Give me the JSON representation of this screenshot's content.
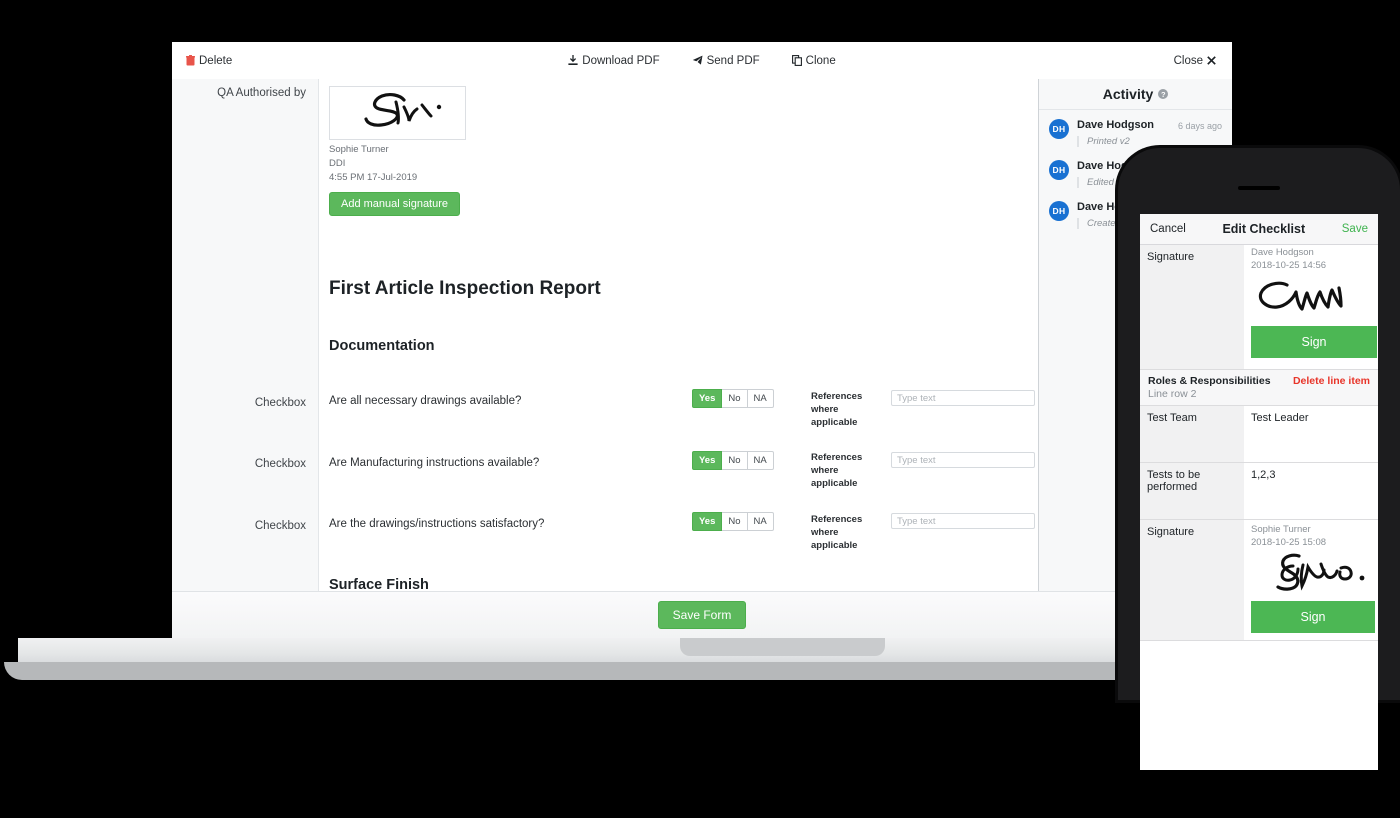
{
  "toolbar": {
    "delete_label": "Delete",
    "download_label": "Download PDF",
    "send_label": "Send PDF",
    "clone_label": "Clone",
    "close_label": "Close",
    "delete_icon": "trash-icon",
    "download_icon": "download-icon",
    "send_icon": "paper-plane-icon",
    "clone_icon": "copy-icon",
    "close_icon": "close-x-icon",
    "delete_color": "#e8544a"
  },
  "signature_block": {
    "label": "QA Authorised by",
    "name": "Sophie Turner",
    "role": "DDI",
    "timestamp": "4:55 PM 17-Jul-2019",
    "add_button": "Add manual signature"
  },
  "form": {
    "title": "First Article Inspection Report",
    "section_1": "Documentation",
    "section_2": "Surface Finish",
    "row_label": "Checkbox",
    "ref_label": "References where applicable",
    "input_placeholder": "Type text",
    "toggle_options": [
      "Yes",
      "No",
      "NA"
    ],
    "rows": [
      {
        "label": "Checkbox",
        "question": "Are all necessary drawings available?",
        "selected": "Yes",
        "ref_label": "References where applicable",
        "value": ""
      },
      {
        "label": "Checkbox",
        "question": "Are Manufacturing instructions available?",
        "selected": "Yes",
        "ref_label": "References where applicable",
        "value": ""
      },
      {
        "label": "Checkbox",
        "question": "Are the drawings/instructions satisfactory?",
        "selected": "Yes",
        "ref_label": "References where applicable",
        "value": ""
      }
    ],
    "save_button": "Save Form"
  },
  "activity": {
    "title": "Activity",
    "help_icon": "question-mark-icon",
    "accent": "#1971d2",
    "items": [
      {
        "initials": "DH",
        "name": "Dave Hodgson",
        "time": "6 days ago",
        "action": "Printed v2"
      },
      {
        "initials": "DH",
        "name": "Dave Hodgson",
        "time": "",
        "action": "Edited"
      },
      {
        "initials": "DH",
        "name": "Dave Hodgson",
        "time": "",
        "action": "Created"
      }
    ]
  },
  "phone": {
    "nav": {
      "cancel": "Cancel",
      "title": "Edit Checklist",
      "save": "Save"
    },
    "rows": [
      {
        "type": "signature",
        "key": "Signature",
        "person": "Dave Hodgson",
        "timestamp": "2018-10-25 14:56",
        "button": "Sign"
      },
      {
        "type": "section",
        "title": "Roles & Responsibilities",
        "subtitle": "Line row 2",
        "delete": "Delete line item"
      },
      {
        "type": "field",
        "key": "Test Team",
        "value": "Test Leader"
      },
      {
        "type": "field",
        "key": "Tests to be performed",
        "value": "1,2,3"
      },
      {
        "type": "signature",
        "key": "Signature",
        "person": "Sophie Turner",
        "timestamp": "2018-10-25 15:08",
        "button": "Sign"
      }
    ]
  },
  "colors": {
    "green": "#5cb85c",
    "phone_green": "#4cb754",
    "red": "#e8352a",
    "blue": "#1971d2"
  }
}
